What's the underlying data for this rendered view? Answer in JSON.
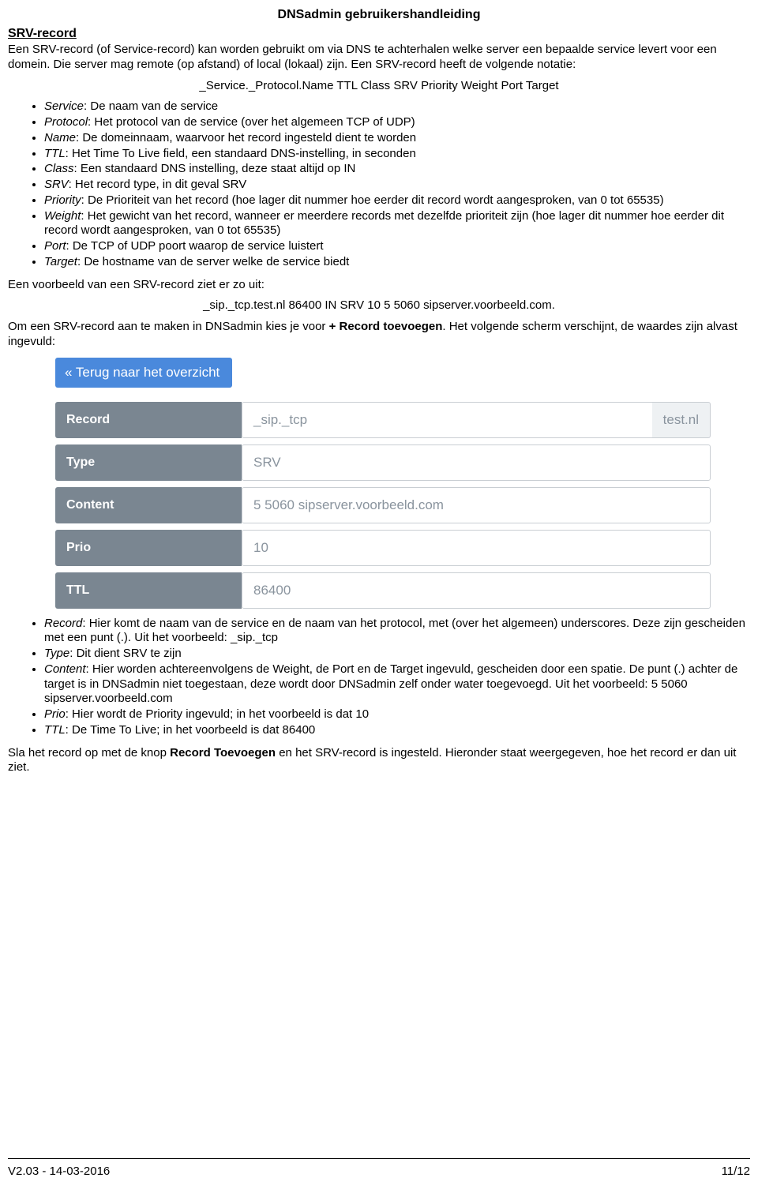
{
  "doc_title": "DNSadmin gebruikershandleiding",
  "section_heading": "SRV-record",
  "intro": "Een SRV-record (of Service-record) kan worden gebruikt om via DNS te achterhalen welke server een bepaalde service levert voor een domein. Die server mag remote (op afstand) of local (lokaal) zijn. Een SRV-record heeft de volgende notatie:",
  "notation": "_Service._Protocol.Name TTL Class SRV Priority Weight Port Target",
  "defs": [
    {
      "term": "Service",
      "text": ": De naam van de service"
    },
    {
      "term": "Protocol",
      "text": ": Het protocol van de service (over het algemeen TCP of UDP)"
    },
    {
      "term": "Name",
      "text": ": De domeinnaam, waarvoor het record ingesteld dient te worden"
    },
    {
      "term": "TTL",
      "text": ": Het Time To Live field, een standaard DNS-instelling, in seconden"
    },
    {
      "term": "Class",
      "text": ": Een standaard DNS instelling, deze staat altijd op IN"
    },
    {
      "term": "SRV",
      "text": ": Het record type, in dit geval SRV"
    },
    {
      "term": "Priority",
      "text": ": De Prioriteit van het record (hoe lager dit nummer hoe eerder dit record wordt aangesproken, van 0 tot 65535)"
    },
    {
      "term": "Weight",
      "text": ": Het gewicht van het record, wanneer er meerdere records met dezelfde prioriteit zijn (hoe lager dit nummer hoe eerder dit record wordt aangesproken, van 0 tot 65535)"
    },
    {
      "term": "Port",
      "text": ": De TCP of UDP poort waarop de service luistert"
    },
    {
      "term": "Target",
      "text": ": De hostname van de server welke de service biedt"
    }
  ],
  "example_intro": "Een voorbeeld van een SRV-record ziet er zo uit:",
  "example_line": "_sip._tcp.test.nl 86400 IN SRV 10 5 5060 sipserver.voorbeeld.com.",
  "add_intro_pre": "Om een SRV-record aan te maken in DNSadmin kies je voor ",
  "add_intro_bold": "+ Record toevoegen",
  "add_intro_post": ". Het volgende scherm verschijnt, de waardes zijn alvast ingevuld:",
  "back_button": "Terug naar het overzicht",
  "form": {
    "record": {
      "label": "Record",
      "value": "_sip._tcp",
      "suffix": "test.nl"
    },
    "type": {
      "label": "Type",
      "value": "SRV"
    },
    "content": {
      "label": "Content",
      "value": "5 5060 sipserver.voorbeeld.com"
    },
    "prio": {
      "label": "Prio",
      "value": "10"
    },
    "ttl": {
      "label": "TTL",
      "value": "86400"
    }
  },
  "notes": [
    {
      "term": "Record",
      "text": ": Hier komt de naam van de service en de naam van het protocol, met (over het algemeen) underscores. Deze zijn gescheiden met een punt (.). Uit het voorbeeld: _sip._tcp"
    },
    {
      "term": "Type",
      "text": ": Dit dient SRV te zijn"
    },
    {
      "term": "Content",
      "text": ": Hier worden achtereenvolgens de Weight, de Port en de Target ingevuld, gescheiden door een spatie. De punt (.) achter de target is in DNSadmin niet toegestaan, deze wordt door DNSadmin zelf onder water toegevoegd. Uit het voorbeeld: 5 5060 sipserver.voorbeeld.com"
    },
    {
      "term": "Prio",
      "text": ": Hier wordt de Priority ingevuld; in het voorbeeld is dat 10"
    },
    {
      "term": "TTL",
      "text": ": De Time To Live; in het voorbeeld is dat 86400"
    }
  ],
  "closing_pre": "Sla het record op met de knop ",
  "closing_bold": "Record Toevoegen",
  "closing_post": " en het SRV-record is ingesteld. Hieronder staat weergegeven, hoe het record er dan uit ziet.",
  "footer_left": "V2.03 - 14-03-2016",
  "footer_right": "11/12"
}
